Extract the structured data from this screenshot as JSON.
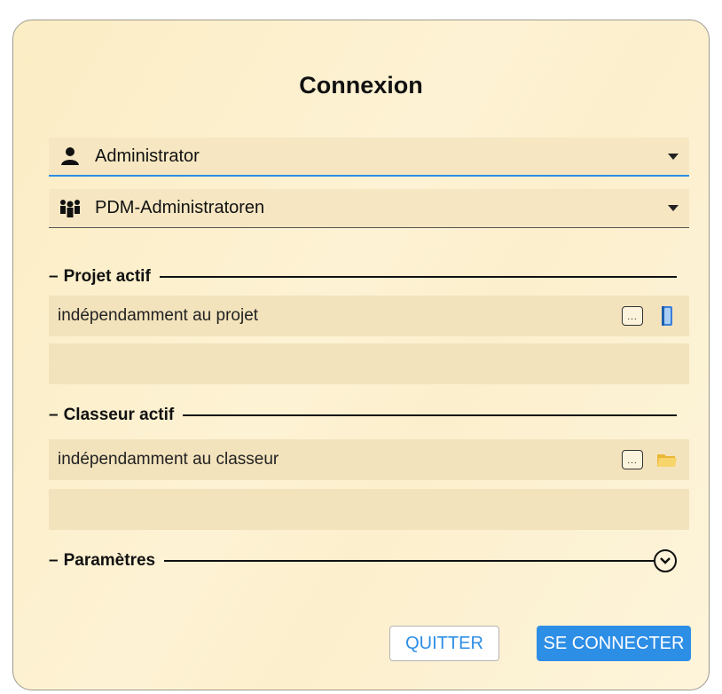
{
  "dialog": {
    "title": "Connexion"
  },
  "user_combo": {
    "value": "Administrator",
    "icon": "user-icon"
  },
  "group_combo": {
    "value": "PDM-Administratoren",
    "icon": "user-group-icon"
  },
  "project": {
    "header": "Projet actif",
    "value": "indépendamment au projet",
    "browse_label": "...",
    "icon": "project-book-icon"
  },
  "folder": {
    "header": "Classeur actif",
    "value": "indépendamment au classeur",
    "browse_label": "...",
    "icon": "folder-icon"
  },
  "settings": {
    "header": "Paramètres",
    "icon": "chevron-down-circle-icon"
  },
  "buttons": {
    "quit": "QUITTER",
    "connect": "SE CONNECTER"
  },
  "colors": {
    "accent": "#2d8ee6",
    "background": "#fcefcd"
  }
}
